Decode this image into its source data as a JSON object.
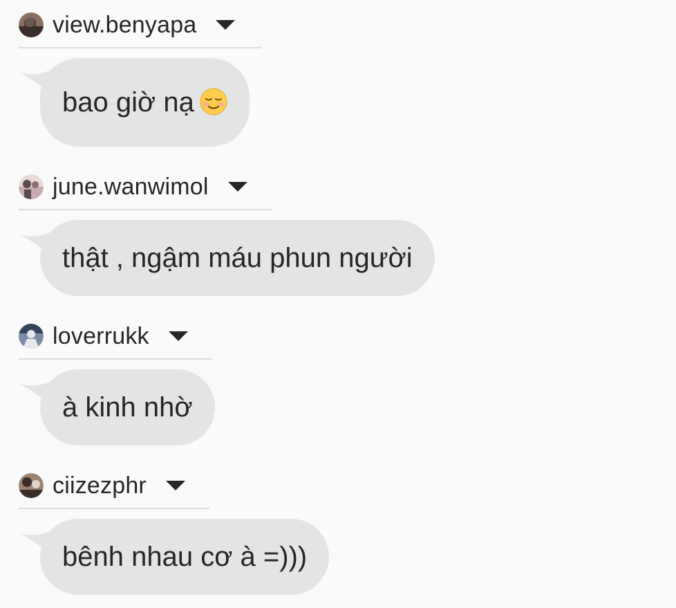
{
  "messages": [
    {
      "username": "view.benyapa",
      "text": "bao giờ nạ",
      "emoji_icon": "smiling-face-icon",
      "avatar_colors": [
        "#3a2e2a",
        "#8b6f63",
        "#d9c2b7"
      ]
    },
    {
      "username": "june.wanwimol",
      "text": "thật , ngậm máu phun người",
      "avatar_colors": [
        "#5b4a4e",
        "#c9aab0",
        "#e8dad9"
      ]
    },
    {
      "username": "loverrukk",
      "text": "à kinh nhờ",
      "avatar_colors": [
        "#34445c",
        "#7d8ba5",
        "#e6e8ee"
      ]
    },
    {
      "username": "ciizezphr",
      "text": "bênh nhau cơ à =)))",
      "avatar_colors": [
        "#3b2f28",
        "#9c8470",
        "#e2d6c8"
      ]
    }
  ],
  "colors": {
    "background": "#fafafa",
    "bubble": "#e4e4e4",
    "divider": "#dbdbdb",
    "text": "#262626"
  }
}
